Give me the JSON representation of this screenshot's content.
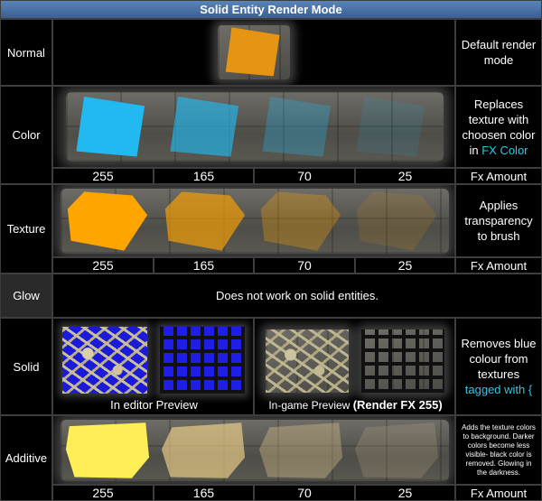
{
  "title": "Solid Entity Render Mode",
  "rows": {
    "normal": {
      "label": "Normal",
      "desc": "Default render mode"
    },
    "color": {
      "label": "Color",
      "desc_text": "Replaces texture with choosen color in",
      "desc_link": "FX Color",
      "amounts": [
        "255",
        "165",
        "70",
        "25"
      ],
      "amount_label": "Fx Amount",
      "fill_color": "#22b8f0",
      "opacities": [
        1.0,
        0.65,
        0.3,
        0.12
      ]
    },
    "texture": {
      "label": "Texture",
      "desc": "Applies transparency to brush",
      "amounts": [
        "255",
        "165",
        "70",
        "25"
      ],
      "amount_label": "Fx Amount",
      "fill_color": "#ffa500",
      "opacities": [
        1.0,
        0.65,
        0.3,
        0.12
      ]
    },
    "glow": {
      "label": "Glow",
      "note": "Does not work on solid entities."
    },
    "solid": {
      "label": "Solid",
      "desc_text": "Removes blue colour from textures",
      "desc_link": "tagged with  {",
      "editor_caption": "In editor  Preview",
      "ingame_caption": "In-game Preview",
      "ingame_caption_bold": "(Render FX 255)"
    },
    "additive": {
      "label": "Additive",
      "desc": "Adds the texture colors to background. Darker colors become less visible- black color is removed. Glowing in the darkness.",
      "amounts": [
        "255",
        "165",
        "70",
        "25"
      ],
      "amount_label": "Fx Amount",
      "fill_color": "#ffee55",
      "opacities": [
        1.0,
        0.6,
        0.3,
        0.15
      ]
    }
  },
  "colors": {
    "title_bg": "#4a72a6",
    "cyan_text": "#2ec8e6",
    "normal_fill": "#e69512"
  }
}
